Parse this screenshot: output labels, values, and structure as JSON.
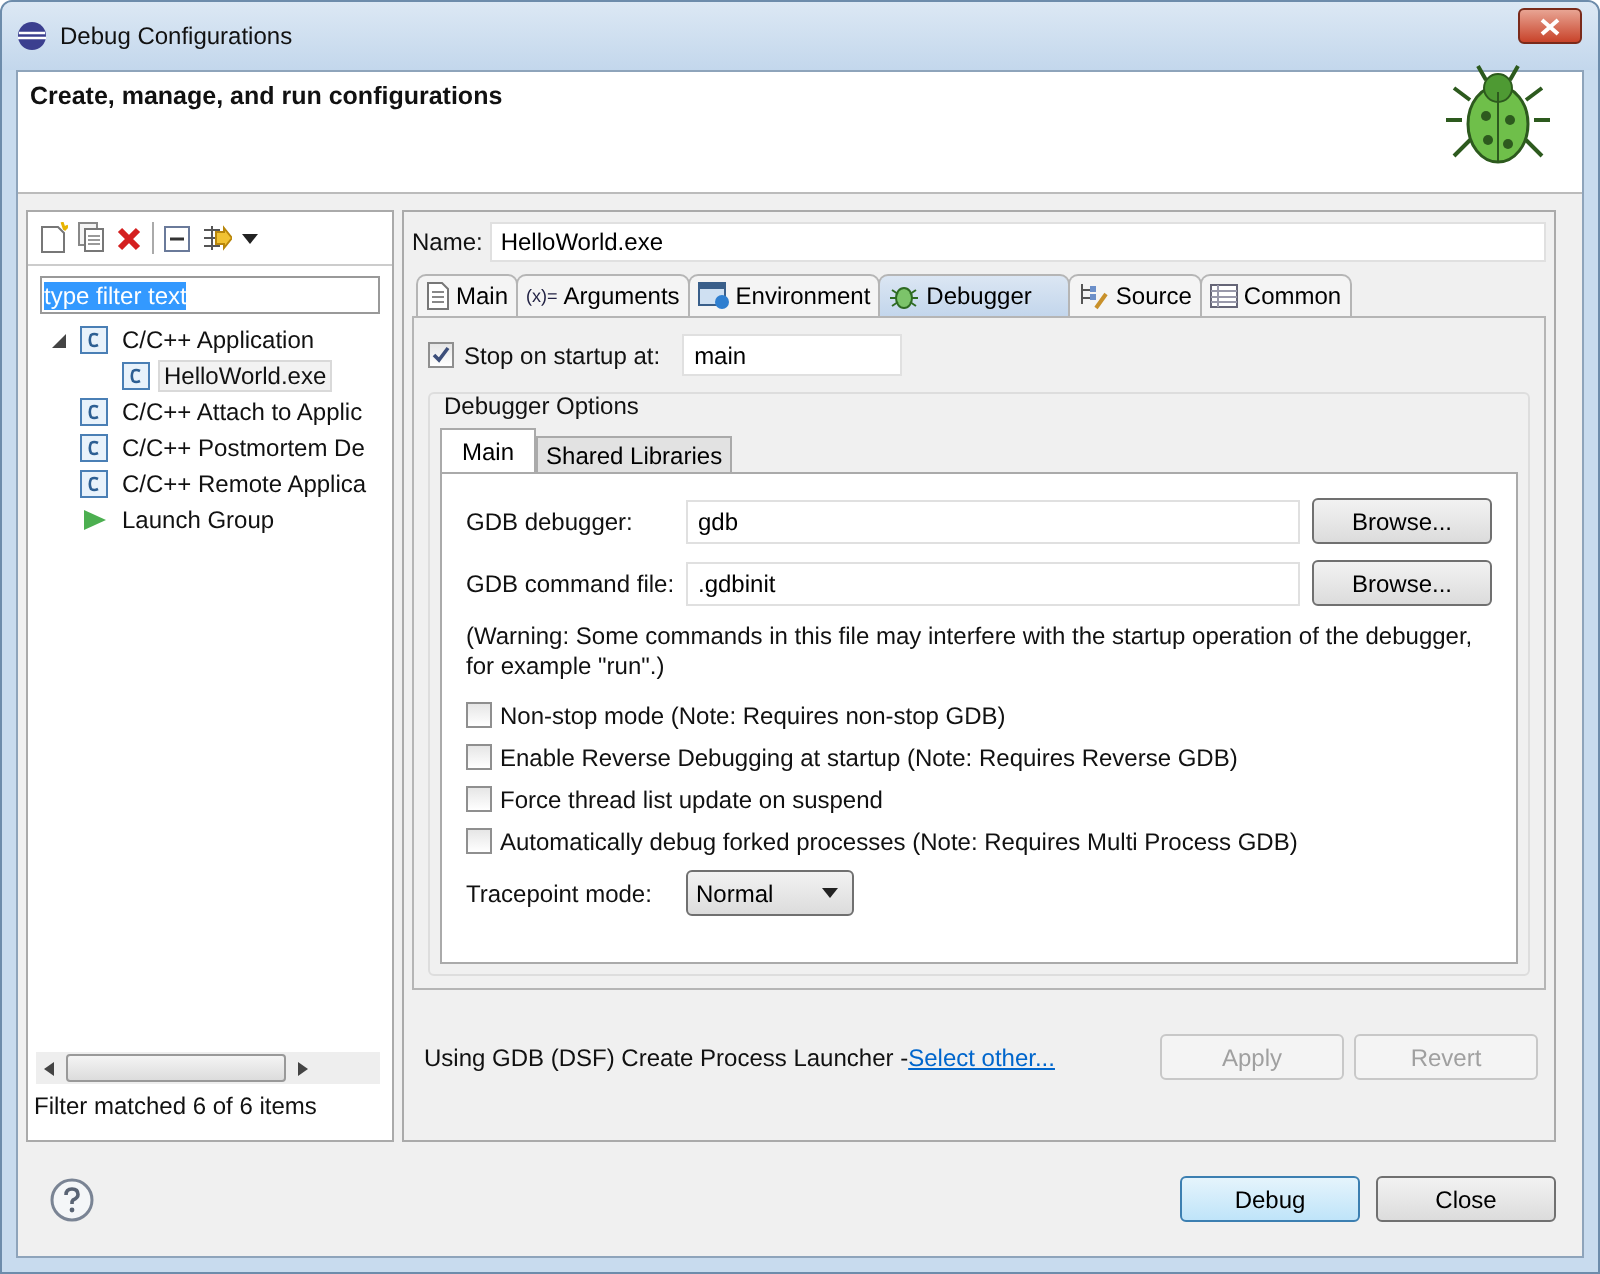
{
  "window": {
    "title": "Debug Configurations"
  },
  "header": {
    "title": "Create, manage, and run configurations"
  },
  "filter": {
    "value": "type filter text"
  },
  "tree": [
    {
      "label": "C/C++ Application",
      "kind": "c",
      "expanded": true,
      "selected": false,
      "children": [
        {
          "label": "HelloWorld.exe",
          "kind": "c",
          "selected": true
        }
      ]
    },
    {
      "label": "C/C++ Attach to Applic",
      "kind": "c",
      "selected": false
    },
    {
      "label": "C/C++ Postmortem De",
      "kind": "c",
      "selected": false
    },
    {
      "label": "C/C++ Remote Applica",
      "kind": "c",
      "selected": false
    },
    {
      "label": "Launch Group",
      "kind": "launch",
      "selected": false
    }
  ],
  "filter_status": "Filter matched 6 of 6 items",
  "name": {
    "label": "Name:",
    "value": "HelloWorld.exe"
  },
  "tabs": [
    {
      "label": "Main",
      "kind": "doc",
      "selected": false
    },
    {
      "label": "Arguments",
      "kind": "args",
      "icon": "(x)=",
      "selected": false
    },
    {
      "label": "Environment",
      "kind": "env",
      "selected": false
    },
    {
      "label": "Debugger",
      "kind": "bug",
      "selected": true
    },
    {
      "label": "Source",
      "kind": "source",
      "selected": false
    },
    {
      "label": "Common",
      "kind": "table",
      "selected": false
    }
  ],
  "stop_on_startup": {
    "label": "Stop on startup at:",
    "checked": true,
    "value": "main"
  },
  "debugger_options": {
    "title": "Debugger Options",
    "tabs": [
      {
        "label": "Main",
        "selected": true
      },
      {
        "label": "Shared Libraries",
        "selected": false
      }
    ],
    "fields": [
      {
        "label": "GDB debugger:",
        "value": "gdb",
        "button": "Browse..."
      },
      {
        "label": "GDB command file:",
        "value": ".gdbinit",
        "button": "Browse..."
      }
    ],
    "warning": "(Warning: Some commands in this file may interfere with the startup operation of the debugger, for example \"run\".)",
    "options": [
      {
        "label": "Non-stop mode (Note: Requires non-stop GDB)",
        "checked": false
      },
      {
        "label": "Enable Reverse Debugging at startup (Note: Requires Reverse GDB)",
        "checked": false
      },
      {
        "label": "Force thread list update on suspend",
        "checked": false
      },
      {
        "label": "Automatically debug forked processes (Note: Requires Multi Process GDB)",
        "checked": false
      }
    ],
    "tracepoint": {
      "label": "Tracepoint mode:",
      "value": "Normal"
    }
  },
  "launcher": {
    "text": "Using GDB (DSF) Create Process Launcher - ",
    "link": "Select other..."
  },
  "panel_buttons": [
    {
      "label": "Apply",
      "disabled": true
    },
    {
      "label": "Revert",
      "disabled": true
    }
  ],
  "dialog_buttons": [
    {
      "label": "Debug",
      "default": true
    },
    {
      "label": "Close",
      "default": false
    }
  ]
}
